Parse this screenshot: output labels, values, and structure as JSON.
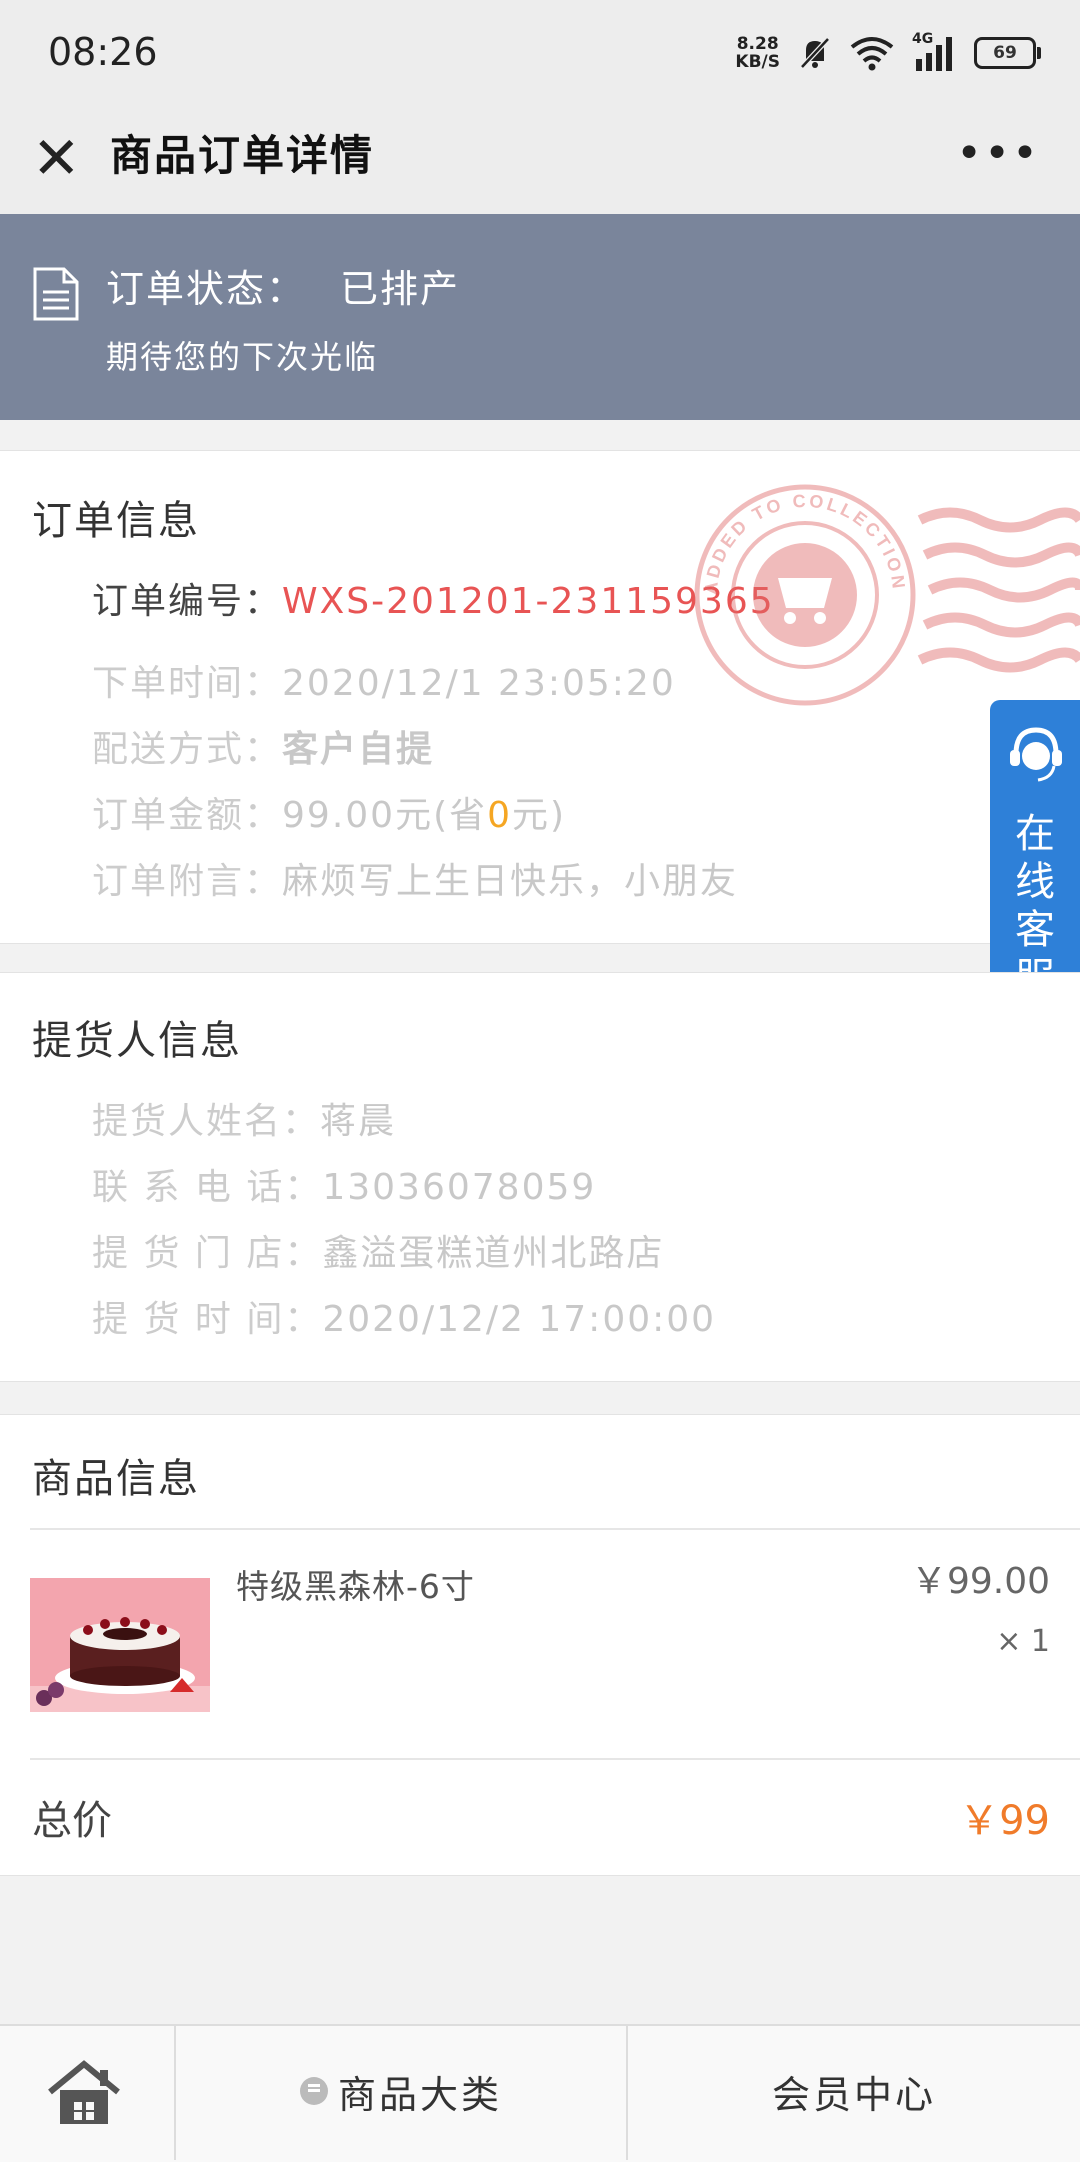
{
  "status_bar": {
    "time": "08:26",
    "speed_value": "8.28",
    "speed_unit": "KB/S",
    "network": "4G",
    "battery": "69"
  },
  "header": {
    "title": "商品订单详情"
  },
  "order_status": {
    "label": "订单状态：",
    "value": "已排产",
    "subtitle": "期待您的下次光临"
  },
  "order_info": {
    "title": "订单信息",
    "number_label": "订单编号：",
    "number_value": "WXS-201201-231159365",
    "time_label": "下单时间：",
    "time_value": "2020/12/1 23:05:20",
    "delivery_label": "配送方式：",
    "delivery_value": "客户自提",
    "amount_label": "订单金额：",
    "amount_value": "99.00元(省",
    "amount_saved": "0",
    "amount_suffix": "元)",
    "note_label": "订单附言：",
    "note_value": "麻烦写上生日快乐，小朋友"
  },
  "stamp": {
    "text": "ADDED TO COLLECTION"
  },
  "online_service": {
    "label": "在线客服"
  },
  "pickup_info": {
    "title": "提货人信息",
    "name_label": "提货人姓名：",
    "name_value": "蒋晨",
    "phone_label": "联 系 电 话：",
    "phone_value": "13036078059",
    "store_label": "提 货 门 店：",
    "store_value": "鑫溢蛋糕道州北路店",
    "time_label": "提 货 时 间：",
    "time_value": "2020/12/2 17:00:00"
  },
  "product_info": {
    "title": "商品信息",
    "items": [
      {
        "name": "特级黑森林-6寸",
        "price": "￥99.00",
        "quantity": "× 1"
      }
    ]
  },
  "total": {
    "label": "总价",
    "value": "￥99"
  },
  "bottom_nav": {
    "category": "商品大类",
    "member": "会员中心"
  },
  "colors": {
    "banner": "#7a859b",
    "order_number": "#e85454",
    "total": "#f07b2a",
    "service": "#2e80d8",
    "saved": "#f5a623"
  }
}
